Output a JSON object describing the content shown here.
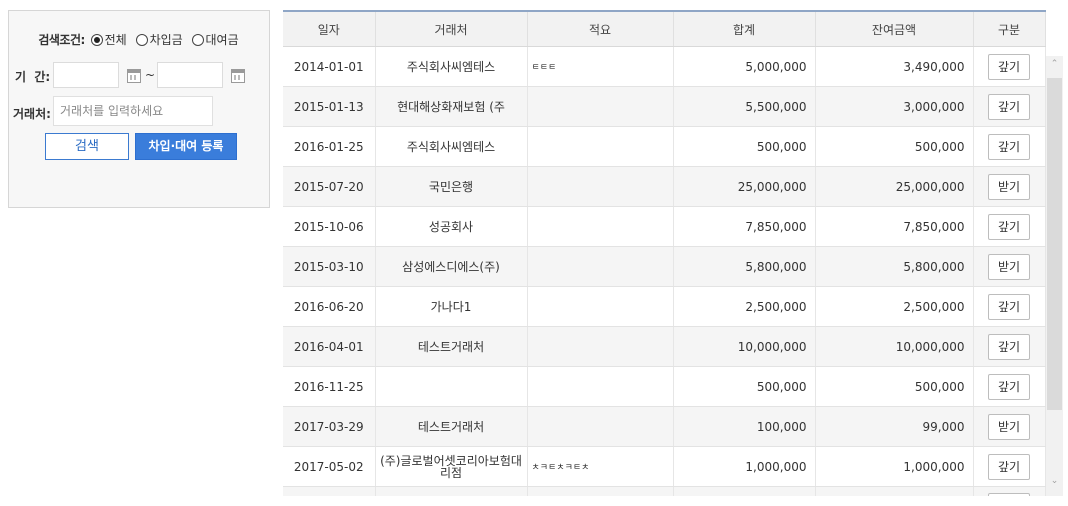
{
  "search": {
    "condition_label": "검색조건:",
    "radio_options": [
      {
        "label": "전체",
        "selected": true
      },
      {
        "label": "차입금",
        "selected": false
      },
      {
        "label": "대여금",
        "selected": false
      }
    ],
    "period_label": "기  간:",
    "tilde": "~",
    "date_from": "",
    "date_to": "",
    "party_label": "거래처:",
    "party_placeholder": "거래처를 입력하세요",
    "search_button": "검색",
    "register_button": "차입·대여 등록"
  },
  "grid": {
    "columns": [
      "일자",
      "거래처",
      "적요",
      "합계",
      "잔여금액",
      "구분"
    ],
    "rows": [
      {
        "date": "2014-01-01",
        "party": "주식회사씨엠테스",
        "memo": "ㅌㅌㅌ",
        "total": "5,000,000",
        "remaining": "3,490,000",
        "action": "갚기"
      },
      {
        "date": "2015-01-13",
        "party": "현대해상화재보험 (주",
        "memo": "",
        "total": "5,500,000",
        "remaining": "3,000,000",
        "action": "갚기"
      },
      {
        "date": "2016-01-25",
        "party": "주식회사씨엠테스",
        "memo": "",
        "total": "500,000",
        "remaining": "500,000",
        "action": "갚기"
      },
      {
        "date": "2015-07-20",
        "party": "국민은행",
        "memo": "",
        "total": "25,000,000",
        "remaining": "25,000,000",
        "action": "받기"
      },
      {
        "date": "2015-10-06",
        "party": "성공회사",
        "memo": "",
        "total": "7,850,000",
        "remaining": "7,850,000",
        "action": "갚기"
      },
      {
        "date": "2015-03-10",
        "party": "삼성에스디에스(주)",
        "memo": "",
        "total": "5,800,000",
        "remaining": "5,800,000",
        "action": "받기"
      },
      {
        "date": "2016-06-20",
        "party": "가나다1",
        "memo": "",
        "total": "2,500,000",
        "remaining": "2,500,000",
        "action": "갚기"
      },
      {
        "date": "2016-04-01",
        "party": "테스트거래처",
        "memo": "",
        "total": "10,000,000",
        "remaining": "10,000,000",
        "action": "갚기"
      },
      {
        "date": "2016-11-25",
        "party": "",
        "memo": "",
        "total": "500,000",
        "remaining": "500,000",
        "action": "갚기"
      },
      {
        "date": "2017-03-29",
        "party": "테스트거래처",
        "memo": "",
        "total": "100,000",
        "remaining": "99,000",
        "action": "받기"
      },
      {
        "date": "2017-05-02",
        "party": "(주)글로벌어셋코리아보험대리점",
        "memo": "ㅊㅋㅌㅊㅋㅌㅊ",
        "total": "1,000,000",
        "remaining": "1,000,000",
        "action": "갚기"
      },
      {
        "date": "",
        "party": "",
        "memo": "",
        "total": "",
        "remaining": "",
        "action": ""
      }
    ]
  }
}
